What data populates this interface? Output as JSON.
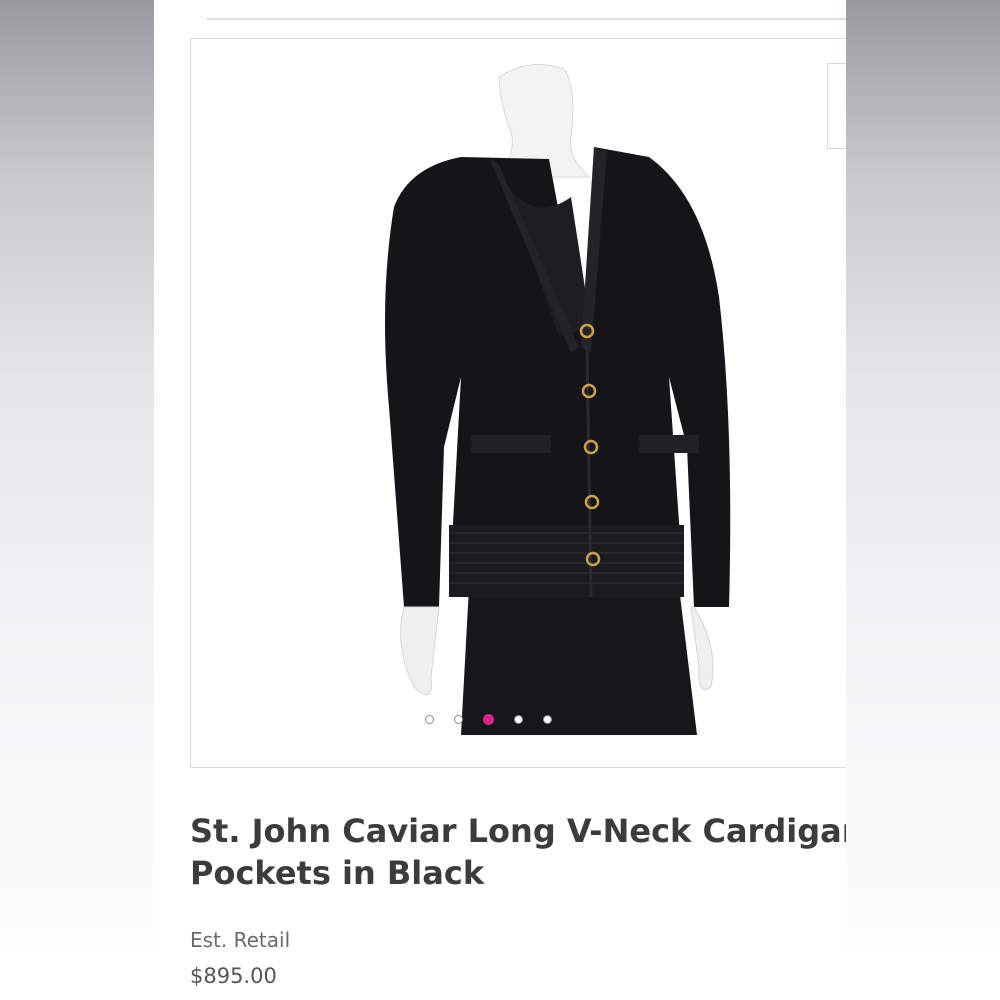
{
  "product": {
    "title_line1": "St. John Caviar Long V-Neck Cardigan w/",
    "title_line2": "Pockets in Black",
    "retail_label": "Est. Retail",
    "price": "$895.00",
    "image_alt": "Black long V-neck cardigan with gold buttons on mannequin"
  },
  "gallery": {
    "slide_count": 5,
    "active_index": 2
  },
  "colors": {
    "accent": "#d7258f",
    "garment": "#151519",
    "button_gold": "#c9a24a"
  },
  "icons": {
    "pagination_dot": "circle-outline",
    "active_dot": "circle-filled"
  }
}
